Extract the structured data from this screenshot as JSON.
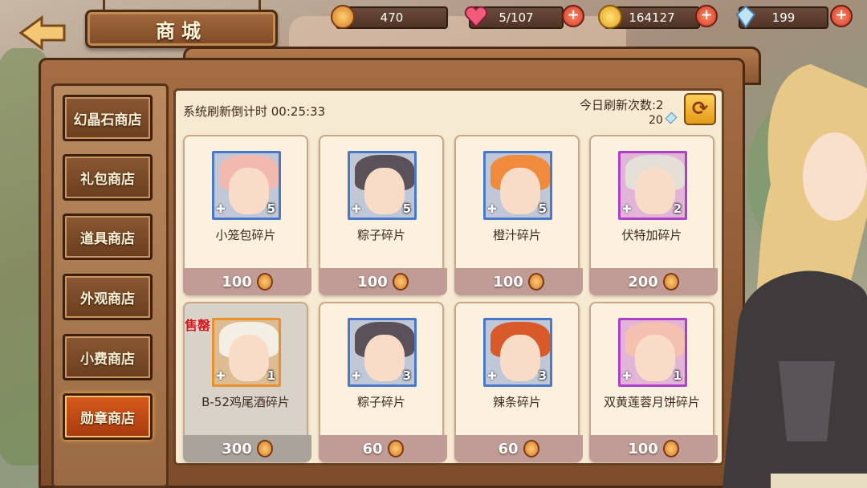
{
  "header": {
    "title": "商城",
    "resources": [
      {
        "icon": "medal-currency-icon",
        "value": "470"
      },
      {
        "icon": "heart-stamina-icon",
        "value": "5/107"
      },
      {
        "icon": "gold-coin-icon",
        "value": "164127"
      },
      {
        "icon": "crystal-gem-icon",
        "value": "199"
      }
    ],
    "plus_label": "+"
  },
  "sidebar": {
    "tabs": [
      {
        "label": "幻晶石商店",
        "active": false
      },
      {
        "label": "礼包商店",
        "active": false
      },
      {
        "label": "道具商店",
        "active": false
      },
      {
        "label": "外观商店",
        "active": false
      },
      {
        "label": "小费商店",
        "active": false
      },
      {
        "label": "勋章商店",
        "active": true
      }
    ]
  },
  "shop": {
    "refresh_timer": "系统刷新倒计时 00:25:33",
    "refresh_count": "今日刷新次数:2",
    "refresh_cost": "20",
    "refresh_icon": "refresh-icon",
    "sold_label": "售罄",
    "items": [
      {
        "name": "小笼包碎片",
        "count": "5",
        "price": "100",
        "sold": false,
        "frame": "#4a78c8",
        "hair": "#f2b9b0"
      },
      {
        "name": "粽子碎片",
        "count": "5",
        "price": "100",
        "sold": false,
        "frame": "#4a78c8",
        "hair": "#5a5258"
      },
      {
        "name": "橙汁碎片",
        "count": "5",
        "price": "100",
        "sold": false,
        "frame": "#4a78c8",
        "hair": "#f08a3c"
      },
      {
        "name": "伏特加碎片",
        "count": "2",
        "price": "200",
        "sold": false,
        "frame": "#b040c8",
        "hair": "#e4e0d8"
      },
      {
        "name": "B-52鸡尾酒碎片",
        "count": "1",
        "price": "300",
        "sold": true,
        "frame": "#e8902c",
        "hair": "#f3efe4"
      },
      {
        "name": "粽子碎片",
        "count": "3",
        "price": "60",
        "sold": false,
        "frame": "#4a78c8",
        "hair": "#5a5258"
      },
      {
        "name": "辣条碎片",
        "count": "3",
        "price": "60",
        "sold": false,
        "frame": "#4a78c8",
        "hair": "#d85a2a"
      },
      {
        "name": "双黄莲蓉月饼碎片",
        "count": "1",
        "price": "100",
        "sold": false,
        "frame": "#b040c8",
        "hair": "#f4c0b0"
      }
    ]
  }
}
